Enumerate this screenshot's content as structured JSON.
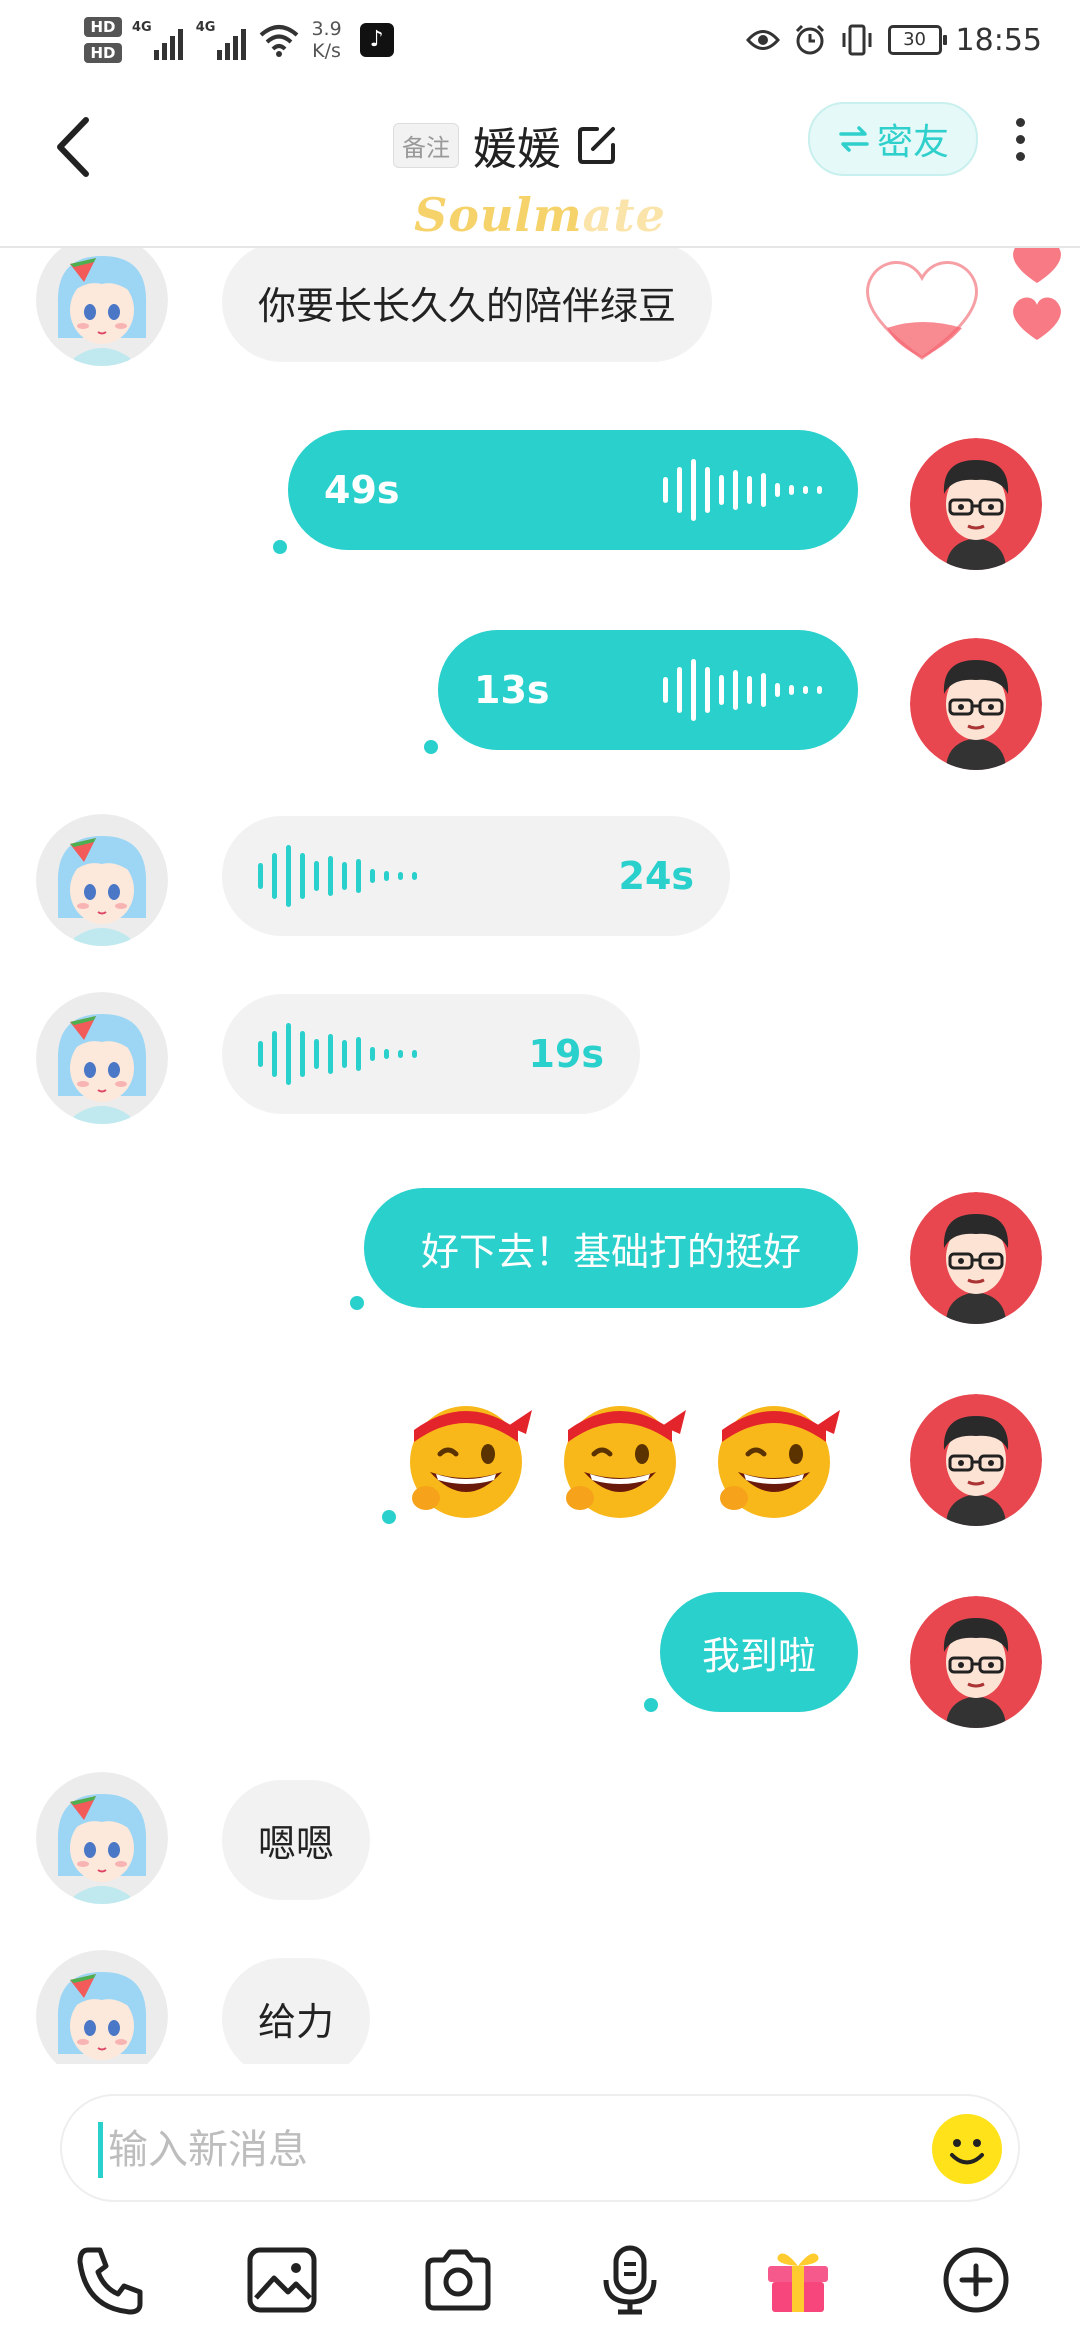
{
  "status_bar": {
    "hd1": "HD",
    "hd2": "HD",
    "net1": "4G",
    "net2": "4G",
    "speed_value": "3.9",
    "speed_unit": "K/s",
    "battery": "30",
    "time": "18:55"
  },
  "header": {
    "remark_tag": "备注",
    "title": "媛媛",
    "friend_button": "密友",
    "brand_bright": "Soulm",
    "brand_faded": "ate"
  },
  "messages": [
    {
      "side": "in",
      "type": "text",
      "text": "你要长长久久的陪伴绿豆"
    },
    {
      "side": "out",
      "type": "voice",
      "duration": "49s"
    },
    {
      "side": "out",
      "type": "voice",
      "duration": "13s"
    },
    {
      "side": "in",
      "type": "voice",
      "duration": "24s"
    },
    {
      "side": "in",
      "type": "voice",
      "duration": "19s"
    },
    {
      "side": "out",
      "type": "text",
      "text": "好下去！基础打的挺好"
    },
    {
      "side": "out",
      "type": "emoji",
      "icon": "winking-face-headband-icon",
      "count": 3
    },
    {
      "side": "out",
      "type": "text",
      "text": "我到啦"
    },
    {
      "side": "in",
      "type": "text",
      "text": "嗯嗯"
    },
    {
      "side": "in",
      "type": "text",
      "text": "给力"
    }
  ],
  "input": {
    "placeholder": "输入新消息"
  },
  "toolbar": [
    "phone-icon",
    "image-icon",
    "camera-icon",
    "voice-icon",
    "gift-icon",
    "plus-icon"
  ],
  "colors": {
    "accent": "#2ad0cc",
    "incoming_bubble": "#f2f2f2",
    "heart": "#f6636e",
    "brand": "#f6d26b"
  }
}
